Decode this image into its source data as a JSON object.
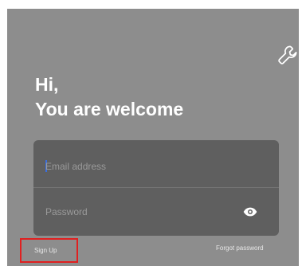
{
  "greeting": {
    "line1": "Hi,",
    "line2": "You are welcome"
  },
  "form": {
    "email": {
      "value": "",
      "placeholder": "Email address"
    },
    "password": {
      "value": "",
      "placeholder": "Password"
    }
  },
  "actions": {
    "signup_label": "Sign Up",
    "forgot_label": "Forgot password"
  },
  "icons": {
    "settings": "wrench-icon",
    "password_toggle": "eye-icon"
  },
  "colors": {
    "background": "#8d8d8d",
    "card": "#5f5f5f",
    "highlight": "#e02020",
    "caret": "#3b6fe0"
  }
}
